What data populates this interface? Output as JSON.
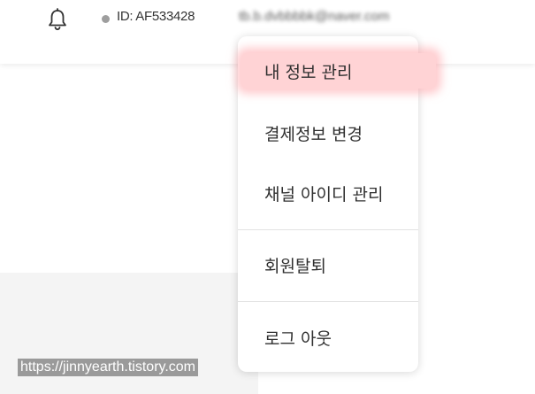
{
  "header": {
    "bell_icon": "bell-icon",
    "status_color": "#9e9e9e",
    "user_id": "ID: AF533428",
    "email": "tb.b.dvbbbbk@naver.com"
  },
  "dropdown": {
    "items": [
      {
        "label": "내 정보 관리",
        "active": true
      },
      {
        "label": "결제정보 변경",
        "active": false
      },
      {
        "label": "채널 아이디 관리",
        "active": false
      },
      {
        "label": "회원탈퇴",
        "active": false
      },
      {
        "label": "로그 아웃",
        "active": false
      }
    ],
    "highlight_color": "#ffd3d5"
  },
  "watermark": {
    "text": "https://jinnyearth.tistory.com"
  }
}
